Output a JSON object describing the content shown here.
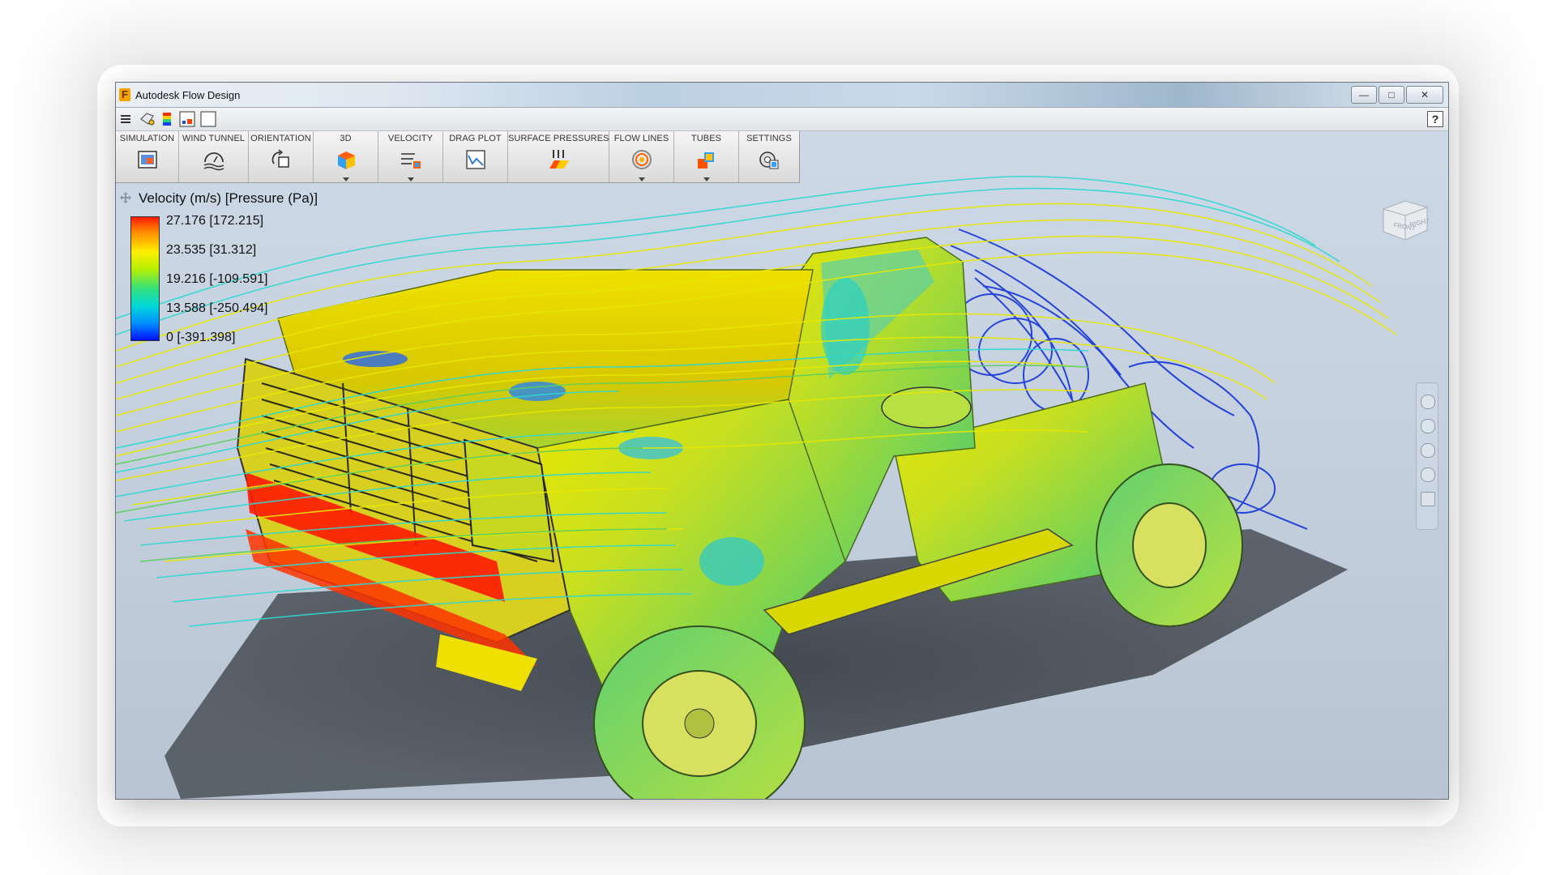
{
  "window": {
    "logo_letter": "F",
    "title": "Autodesk Flow Design",
    "minimize": "—",
    "maximize": "□",
    "close": "✕"
  },
  "quickbar": {
    "help": "?",
    "icons": [
      "menu-icon",
      "save-icon",
      "colorbar-icon",
      "chart-icon",
      "blank-doc-icon"
    ]
  },
  "ribbon": {
    "buttons": [
      {
        "label": "SIMULATION",
        "icon": "simulation-icon",
        "dropdown": false
      },
      {
        "label": "WIND TUNNEL",
        "icon": "wind-tunnel-icon",
        "dropdown": false
      },
      {
        "label": "ORIENTATION",
        "icon": "orientation-icon",
        "dropdown": false
      },
      {
        "label": "3D",
        "icon": "3d-icon",
        "dropdown": true
      },
      {
        "label": "VELOCITY",
        "icon": "velocity-icon",
        "dropdown": true
      },
      {
        "label": "DRAG PLOT",
        "icon": "drag-plot-icon",
        "dropdown": false
      },
      {
        "label": "SURFACE PRESSURES",
        "icon": "surface-pressures-icon",
        "dropdown": false
      },
      {
        "label": "FLOW LINES",
        "icon": "flow-lines-icon",
        "dropdown": true
      },
      {
        "label": "TUBES",
        "icon": "tubes-icon",
        "dropdown": true
      },
      {
        "label": "SETTINGS",
        "icon": "settings-icon",
        "dropdown": false
      }
    ]
  },
  "legend": {
    "title": "Velocity (m/s) [Pressure (Pa)]",
    "values": [
      "27.176 [172.215]",
      "23.535 [31.312]",
      "19.216 [-109.591]",
      "13.588 [-250.494]",
      "0 [-391.398]"
    ],
    "colors": [
      "#ff1a00",
      "#ffee00",
      "#33e07a",
      "#00d8d8",
      "#0010ff"
    ]
  },
  "navcube": {
    "front": "FRONT",
    "right": "RIGHT"
  },
  "colors": {
    "accent": "#f5a300",
    "background": "#c9d6e4"
  }
}
